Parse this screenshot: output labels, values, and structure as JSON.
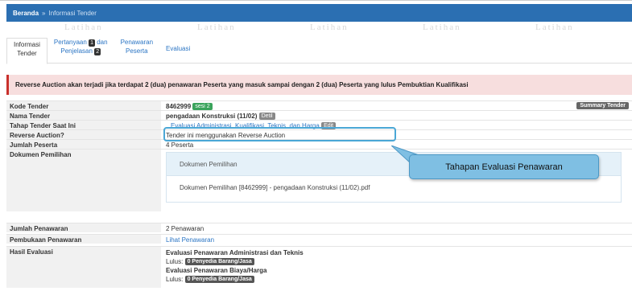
{
  "breadcrumb": {
    "home": "Beranda",
    "separator": "»",
    "current": "Informasi Tender"
  },
  "watermark_text": "Latihan",
  "tabs": [
    {
      "line1": "Informasi",
      "line2": "Tender"
    },
    {
      "line1": "Pertanyaan",
      "badge1": "1",
      "line1b": "dan",
      "line2": "Penjelasan",
      "badge2": "2"
    },
    {
      "line1": "Penawaran",
      "line2": "Peserta"
    },
    {
      "line1": "Evaluasi"
    }
  ],
  "alert_text": "Reverse Auction akan terjadi jika terdapat 2 (dua) penawaran Peserta yang masuk sampai dengan 2 (dua) Peserta yang lulus Pembuktian Kualifikasi",
  "rows": {
    "kode": {
      "label": "Kode Tender",
      "value": "8462999",
      "badge": "sesi 2",
      "summary": "Summary Tender"
    },
    "nama": {
      "label": "Nama Tender",
      "value": "pengadaan Konstruksi (11/02)",
      "badge": "Detil"
    },
    "tahap": {
      "label": "Tahap Tender Saat Ini",
      "value": "Evaluasi Administrasi, Kualifikasi, Teknis, dan Harga",
      "badge": "Edit"
    },
    "reverse": {
      "label": "Reverse Auction?",
      "value": "Tender ini menggunakan Reverse Auction"
    },
    "jumlah_peserta": {
      "label": "Jumlah Peserta",
      "value": "4 Peserta"
    },
    "dokumen": {
      "label": "Dokumen Pemilihan",
      "panel_title": "Dokumen Pemilihan",
      "file": "Dokumen Pemilihan [8462999] - pengadaan Konstruksi (11/02).pdf"
    },
    "jumlah_penawaran": {
      "label": "Jumlah Penawaran",
      "value": "2 Penawaran"
    },
    "pembukaan": {
      "label": "Pembukaan Penawaran",
      "value": "Lihat Penawaran"
    },
    "hasil": {
      "label": "Hasil Evaluasi",
      "line1": "Evaluasi Penawaran Administrasi dan Teknis",
      "lulus_label": "Lulus:",
      "badge1": "0 Penyedia Barang/Jasa",
      "line2": "Evaluasi Penawaran Biaya/Harga",
      "badge2": "0 Penyedia Barang/Jasa"
    }
  },
  "callout_text": "Tahapan Evaluasi Penawaran"
}
